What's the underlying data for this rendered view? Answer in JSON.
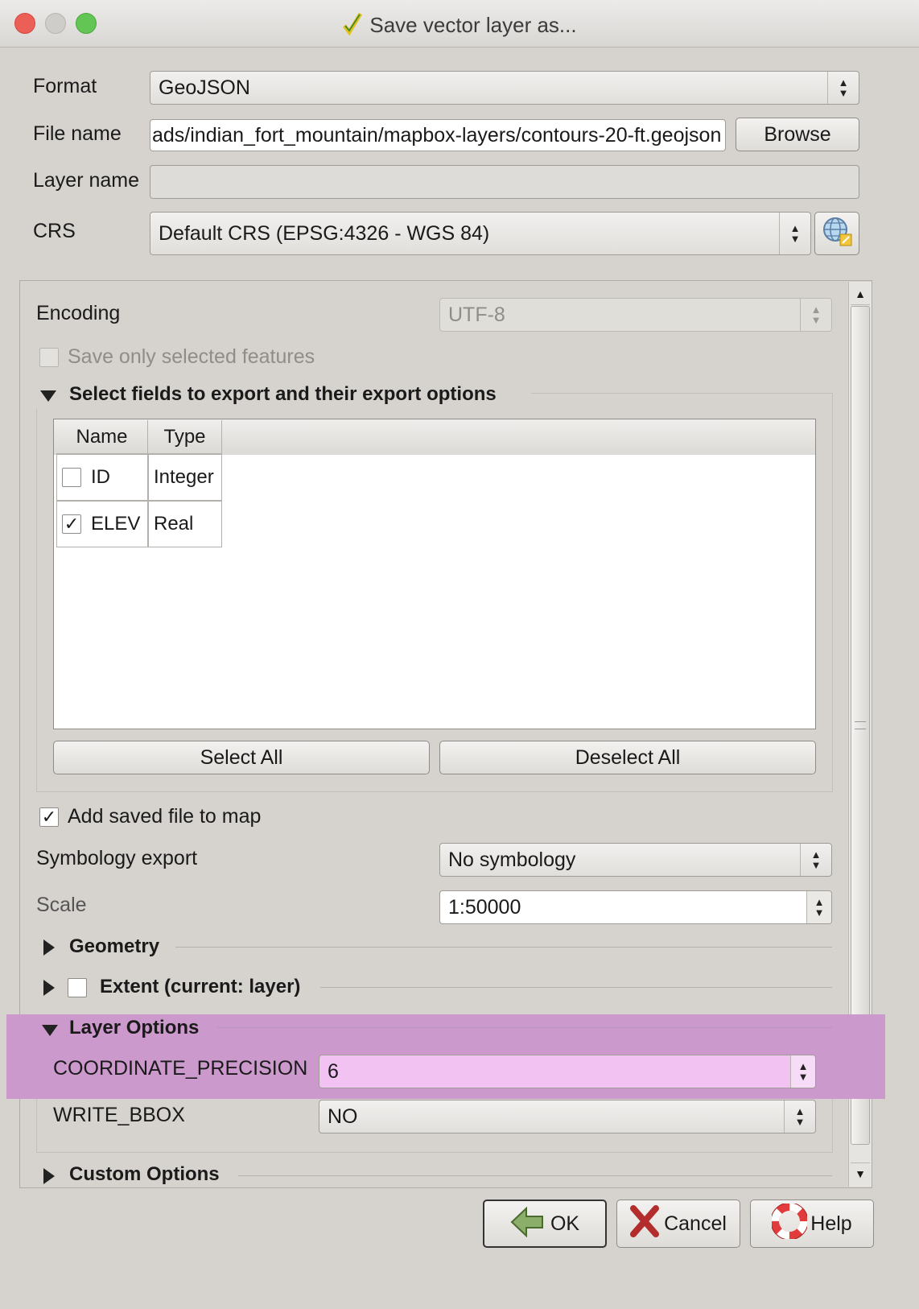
{
  "window": {
    "title": "Save vector layer as..."
  },
  "form": {
    "format_label": "Format",
    "format_value": "GeoJSON",
    "filename_label": "File name",
    "filename_value": "ads/indian_fort_mountain/mapbox-layers/contours-20-ft.geojson",
    "browse_label": "Browse",
    "layername_label": "Layer name",
    "layername_value": "",
    "crs_label": "CRS",
    "crs_value": "Default CRS (EPSG:4326 - WGS 84)"
  },
  "options": {
    "encoding_label": "Encoding",
    "encoding_value": "UTF-8",
    "save_selected_label": "Save only selected features",
    "save_selected_checked": false,
    "fields_section_title": "Select fields to export and their export options",
    "table_headers": [
      "Name",
      "Type"
    ],
    "table_rows": [
      {
        "name": "ID",
        "type": "Integer",
        "checked": false
      },
      {
        "name": "ELEV",
        "type": "Real",
        "checked": true
      }
    ],
    "select_all_label": "Select All",
    "deselect_all_label": "Deselect All",
    "add_to_map_label": "Add saved file to map",
    "add_to_map_checked": true,
    "symbology_label": "Symbology export",
    "symbology_value": "No symbology",
    "scale_label": "Scale",
    "scale_value": "1:50000",
    "geometry_section_title": "Geometry",
    "extent_section_title": "Extent (current: layer)",
    "layer_options_title": "Layer Options",
    "coord_precision_label": "COORDINATE_PRECISION",
    "coord_precision_value": "6",
    "write_bbox_label": "WRITE_BBOX",
    "write_bbox_value": "NO",
    "custom_options_title": "Custom Options"
  },
  "buttons": {
    "ok_label": "OK",
    "cancel_label": "Cancel",
    "help_label": "Help"
  },
  "colors": {
    "highlight": "#cc99cc",
    "highlight_input": "#f2c2f2",
    "window_bg": "#d6d3ce"
  }
}
